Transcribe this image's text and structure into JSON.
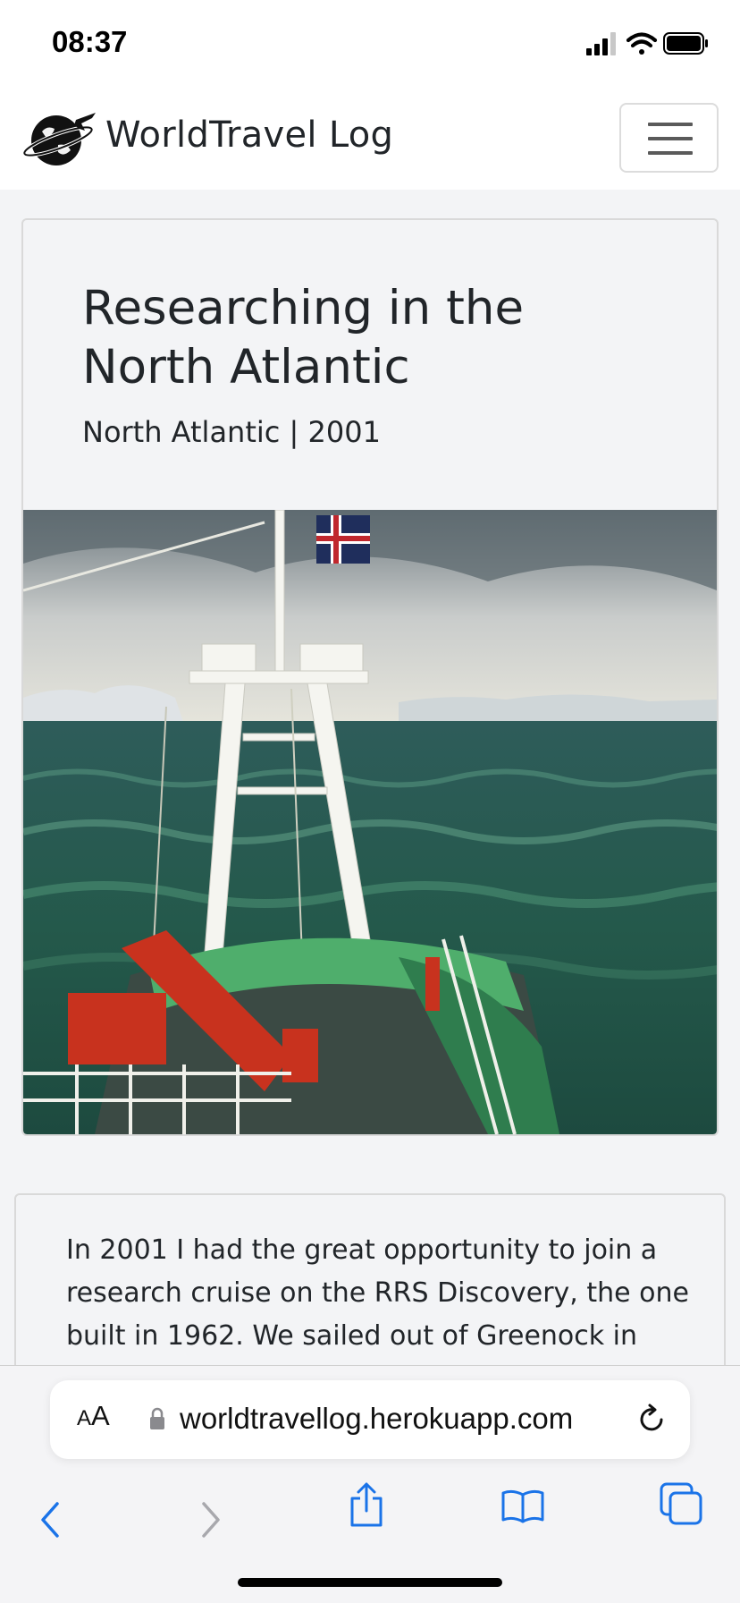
{
  "status_bar": {
    "time": "08:37",
    "icons": [
      "cellular-signal-icon",
      "wifi-icon",
      "battery-icon"
    ]
  },
  "navbar": {
    "brand": "WorldTravel Log",
    "logo_icon": "globe-airplane-logo-icon",
    "menu_icon": "hamburger-menu-icon"
  },
  "hero": {
    "title": "Researching in the North Atlantic",
    "subtitle": "North Atlantic | 2001",
    "image_icon": "ship-at-sea-photo"
  },
  "article": {
    "text": "In 2001 I had the great opportunity to join a research cruise on the RRS Discovery, the one built in 1962. We sailed out of Greenock in"
  },
  "browser": {
    "text_size_small": "A",
    "text_size_large": "A",
    "url": "worldtravellog.herokuapp.com",
    "icons": [
      "back-icon",
      "forward-icon",
      "share-icon",
      "bookmarks-icon",
      "tabs-icon",
      "lock-icon",
      "reload-icon"
    ]
  },
  "colors": {
    "page_background": "#f3f4f6",
    "text": "#212529",
    "safari_blue": "#1a73e8",
    "disabled": "#a8a8ad"
  }
}
